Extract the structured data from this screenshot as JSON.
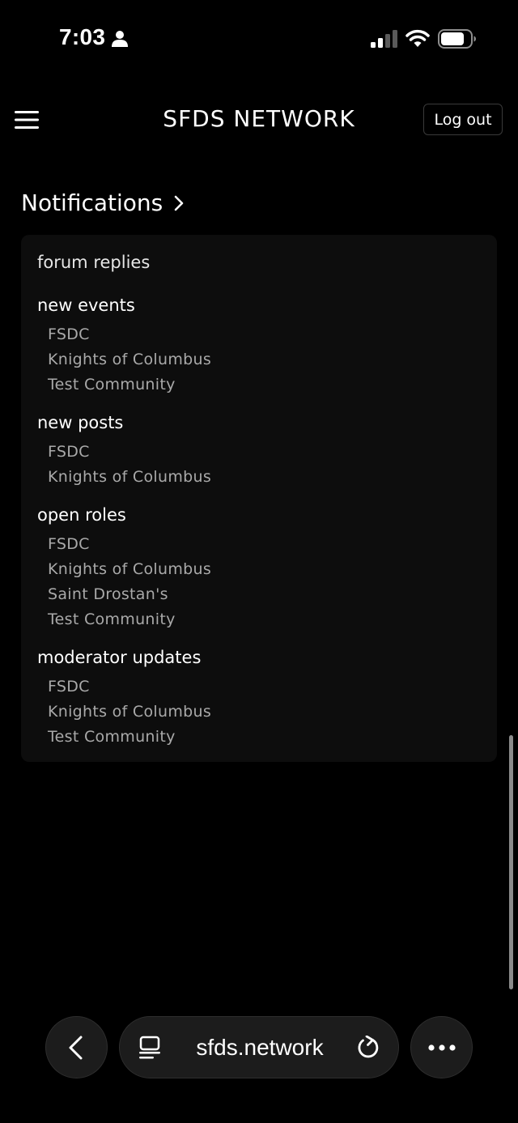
{
  "status_bar": {
    "time": "7:03",
    "icons": [
      "person-icon",
      "signal-icon",
      "wifi-icon",
      "battery-icon"
    ]
  },
  "header": {
    "menu_icon": "hamburger-menu-icon",
    "title": "SFDS NETWORK",
    "logout_label": "Log out"
  },
  "notifications": {
    "heading": "Notifications",
    "heading_icon": "chevron-right-icon",
    "forum_replies_label": "forum replies",
    "sections": [
      {
        "title": "new events",
        "items": [
          "FSDC",
          "Knights of Columbus",
          "Test Community"
        ]
      },
      {
        "title": "new posts",
        "items": [
          "FSDC",
          "Knights of Columbus"
        ]
      },
      {
        "title": "open roles",
        "items": [
          "FSDC",
          "Knights of Columbus",
          "Saint Drostan's",
          "Test Community"
        ]
      },
      {
        "title": "moderator updates",
        "items": [
          "FSDC",
          "Knights of Columbus",
          "Test Community"
        ]
      }
    ]
  },
  "browser_toolbar": {
    "url": "sfds.network",
    "icons": [
      "back-icon",
      "tabs-icon",
      "reload-icon",
      "more-icon"
    ]
  },
  "colors": {
    "background": "#000000",
    "card": "#0d0d0d",
    "muted_text": "#a9a9a9"
  }
}
